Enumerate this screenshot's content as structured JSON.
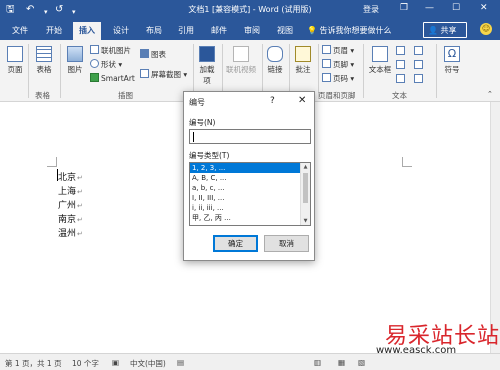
{
  "titlebar": {
    "title": "文档1 [兼容模式] - Word (试用版)",
    "login": "登录",
    "save_icon": "🖫",
    "undo_icon": "↶",
    "redo_icon": "↺",
    "qa_icon": "▾",
    "restore_icon": "❐",
    "min_icon": "—",
    "max_icon": "☐",
    "close_icon": "✕"
  },
  "tabs": [
    "文件",
    "开始",
    "插入",
    "设计",
    "布局",
    "引用",
    "邮件",
    "审阅",
    "视图"
  ],
  "active_tab": "插入",
  "tell_me": "告诉我你想要做什么",
  "share": "共享",
  "ribbon": {
    "page": "页面",
    "table": "表格",
    "table_group": "表格",
    "picture": "图片",
    "online_picture": "联机图片",
    "shapes": "形状",
    "smartart": "SmartArt",
    "chart": "图表",
    "screenshot": "屏幕截图",
    "illustrations_group": "插图",
    "addins": "加载项",
    "online_video": "联机视频",
    "link": "链接",
    "comment": "批注",
    "header": "页眉",
    "footer": "页脚",
    "page_number": "页码",
    "header_footer_group": "页眉和页脚",
    "textbox": "文本框",
    "text_group": "文本",
    "symbol": "符号"
  },
  "document": {
    "lines": [
      "北京",
      "上海",
      "广州",
      "南京",
      "温州"
    ],
    "para_mark": "↵"
  },
  "dialog": {
    "title": "编号",
    "help": "?",
    "close": "✕",
    "number_label": "编号(N)",
    "number_value": "",
    "type_label": "编号类型(T)",
    "types": [
      "1, 2, 3, ...",
      "A, B, C, ...",
      "a, b, c, ...",
      "I, II, III, ...",
      "i, ii, iii, ...",
      "甲, 乙, 丙 ..."
    ],
    "selected_index": 0,
    "ok": "确定",
    "cancel": "取消"
  },
  "statusbar": {
    "page": "第 1 页，共 1 页",
    "words": "10 个字",
    "lang": "中文(中国)"
  },
  "watermark": {
    "text": "易采站长站",
    "url": "www.easck.com"
  }
}
